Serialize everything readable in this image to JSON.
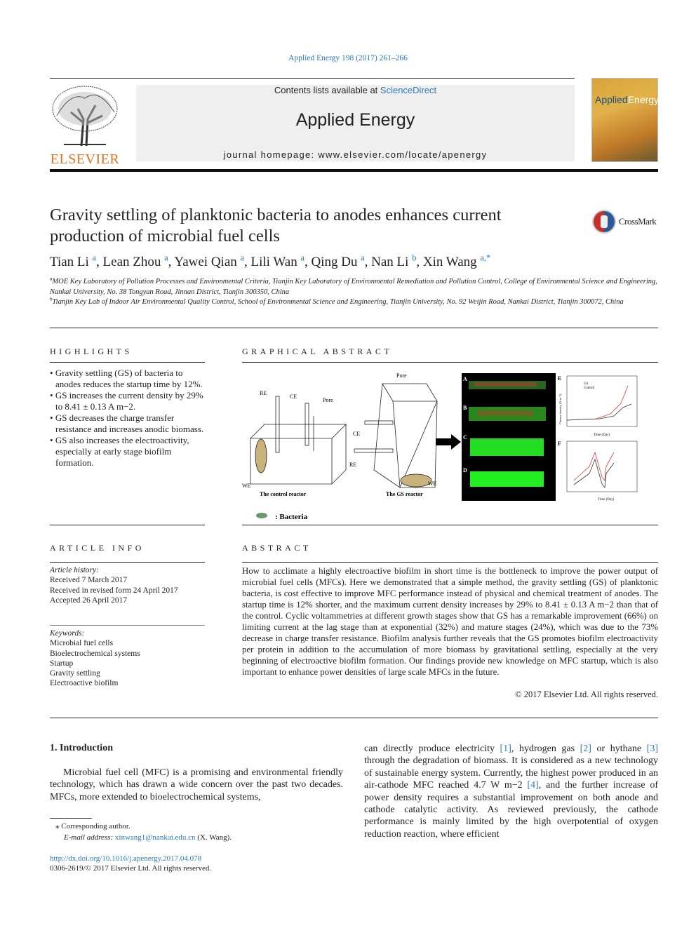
{
  "header": {
    "citation": "Applied Energy 198 (2017) 261–266",
    "contents_prefix": "Contents lists available at ",
    "contents_link": "ScienceDirect",
    "journal_title": "Applied Energy",
    "homepage_prefix": "journal homepage: ",
    "homepage_url": "www.elsevier.com/locate/apenergy",
    "publisher_logo": "ELSEVIER",
    "cover_title_1": "Applied",
    "cover_title_2": "Energy"
  },
  "article": {
    "title": "Gravity settling of planktonic bacteria to anodes enhances current production of microbial fuel cells",
    "crossmark": "CrossMark",
    "authors": [
      {
        "name": "Tian Li",
        "sup": "a"
      },
      {
        "name": "Lean Zhou",
        "sup": "a"
      },
      {
        "name": "Yawei Qian",
        "sup": "a"
      },
      {
        "name": "Lili Wan",
        "sup": "a"
      },
      {
        "name": "Qing Du",
        "sup": "a"
      },
      {
        "name": "Nan Li",
        "sup": "b"
      },
      {
        "name": "Xin Wang",
        "sup": "a,*"
      }
    ],
    "affiliations": [
      {
        "sup": "a",
        "text": "MOE Key Laboratory of Pollution Processes and Environmental Criteria, Tianjin Key Laboratory of Environmental Remediation and Pollution Control, College of Environmental Science and Engineering, Nankai University, No. 38 Tongyan Road, Jinnan District, Tianjin 300350, China"
      },
      {
        "sup": "b",
        "text": "Tianjin Key Lab of Indoor Air Environmental Quality Control, School of Environmental Science and Engineering, Tianjin University, No. 92 Weijin Road, Nankai District, Tianjin 300072, China"
      }
    ]
  },
  "highlights": {
    "heading": "HIGHLIGHTS",
    "items": [
      "Gravity settling (GS) of bacteria to anodes reduces the startup time by 12%.",
      "GS increases the current density by 29% to 8.41 ± 0.13 A m−2.",
      "GS decreases the charge transfer resistance and increases anodic biomass.",
      "GS also increases the electroactivity, especially at early stage biofilm formation."
    ]
  },
  "graphical_abstract": {
    "heading": "GRAPHICAL ABSTRACT",
    "labels": {
      "re": "RE",
      "ce": "CE",
      "pore": "Pore",
      "we": "WE",
      "control_reactor": "The control reactor",
      "gs_reactor": "The GS reactor",
      "bacteria": ": Bacteria",
      "panel_a": "A",
      "panel_b": "B",
      "panel_c": "C",
      "panel_d": "D",
      "panel_e": "E",
      "panel_f": "F",
      "gs": "GS",
      "control": "Control",
      "time": "Time (Day)",
      "current": "Current density (A m⁻²)"
    }
  },
  "article_info": {
    "heading": "ARTICLE INFO",
    "history_label": "Article history:",
    "history": [
      "Received 7 March 2017",
      "Received in revised form 24 April 2017",
      "Accepted 26 April 2017"
    ],
    "keywords_label": "Keywords:",
    "keywords": [
      "Microbial fuel cells",
      "Bioelectrochemical systems",
      "Startup",
      "Gravity settling",
      "Electroactive biofilm"
    ]
  },
  "abstract": {
    "heading": "ABSTRACT",
    "text": "How to acclimate a highly electroactive biofilm in short time is the bottleneck to improve the power output of microbial fuel cells (MFCs). Here we demonstrated that a simple method, the gravity settling (GS) of planktonic bacteria, is cost effective to improve MFC performance instead of physical and chemical treatment of anodes. The startup time is 12% shorter, and the maximum current density increases by 29% to 8.41 ± 0.13 A m−2 than that of the control. Cyclic voltammetries at different growth stages show that GS has a remarkable improvement (66%) on limiting current at the lag stage than at exponential (32%) and mature stages (24%), which was due to the 73% decrease in charge transfer resistance. Biofilm analysis further reveals that the GS promotes biofilm electroactivity per protein in addition to the accumulation of more biomass by gravitational settling, especially at the very beginning of electroactive biofilm formation. Our findings provide new knowledge on MFC startup, which is also important to enhance power densities of large scale MFCs in the future.",
    "copyright": "© 2017 Elsevier Ltd. All rights reserved."
  },
  "introduction": {
    "heading": "1. Introduction",
    "left_text": "Microbial fuel cell (MFC) is a promising and environmental friendly technology, which has drawn a wide concern over the past two decades. MFCs, more extended to bioelectrochemical systems,",
    "right_text_1": "can directly produce electricity ",
    "ref1": "[1]",
    "right_text_2": ", hydrogen gas ",
    "ref2": "[2]",
    "right_text_3": " or hythane ",
    "ref3": "[3]",
    "right_text_4": " through the degradation of biomass. It is considered as a new technology of sustainable energy system. Currently, the highest power produced in an air-cathode MFC reached 4.7 W m−2 ",
    "ref4": "[4]",
    "right_text_5": ", and the further increase of power density requires a substantial improvement on both anode and cathode catalytic activity. As reviewed previously, the cathode performance is mainly limited by the high overpotential of oxygen reduction reaction, where efficient"
  },
  "footnotes": {
    "corresponding_mark": "⁎",
    "corresponding": "Corresponding author.",
    "email_label": "E-mail address: ",
    "email": "xinwang1@nankai.edu.cn",
    "email_suffix": " (X. Wang).",
    "doi": "http://dx.doi.org/10.1016/j.apenergy.2017.04.078",
    "issn": "0306-2619/© 2017 Elsevier Ltd. All rights reserved."
  }
}
